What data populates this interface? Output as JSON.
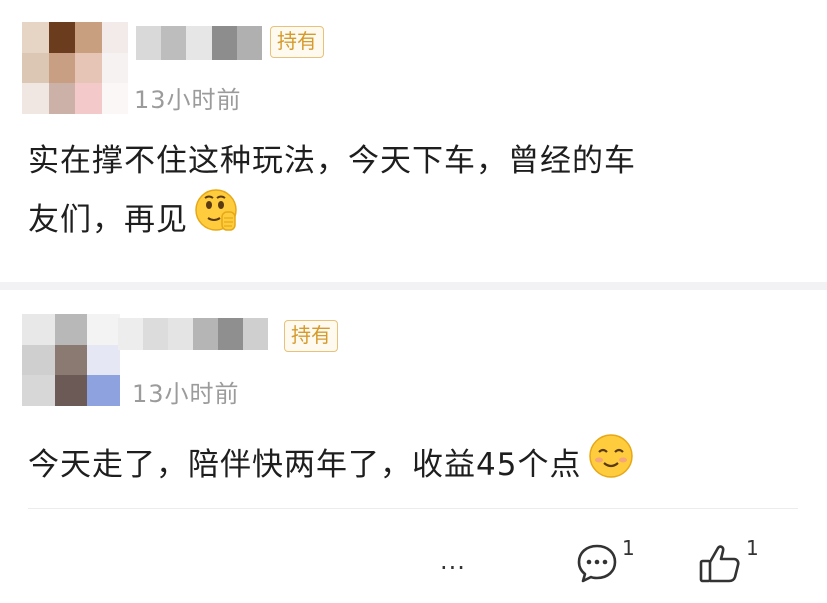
{
  "posts": [
    {
      "badge": "持有",
      "time": "13小时前",
      "content_line1": "实在撑不住这种玩法，今天下车，曾经的车",
      "content_line2": "友们，再见",
      "emoji": "salute-face-emoji"
    },
    {
      "badge": "持有",
      "time": "13小时前",
      "content": "今天走了，陪伴快两年了，收益45个点",
      "emoji": "smiling-face-emoji"
    }
  ],
  "actions": {
    "more": "···",
    "comment_count": "1",
    "like_count": "1"
  },
  "colors": {
    "badge_border": "#e8c27a",
    "badge_text": "#d69a2b",
    "time_text": "#9b9b9b",
    "divider": "#f2f2f4"
  },
  "icons": [
    "more-icon",
    "comment-icon",
    "thumbs-up-icon"
  ]
}
